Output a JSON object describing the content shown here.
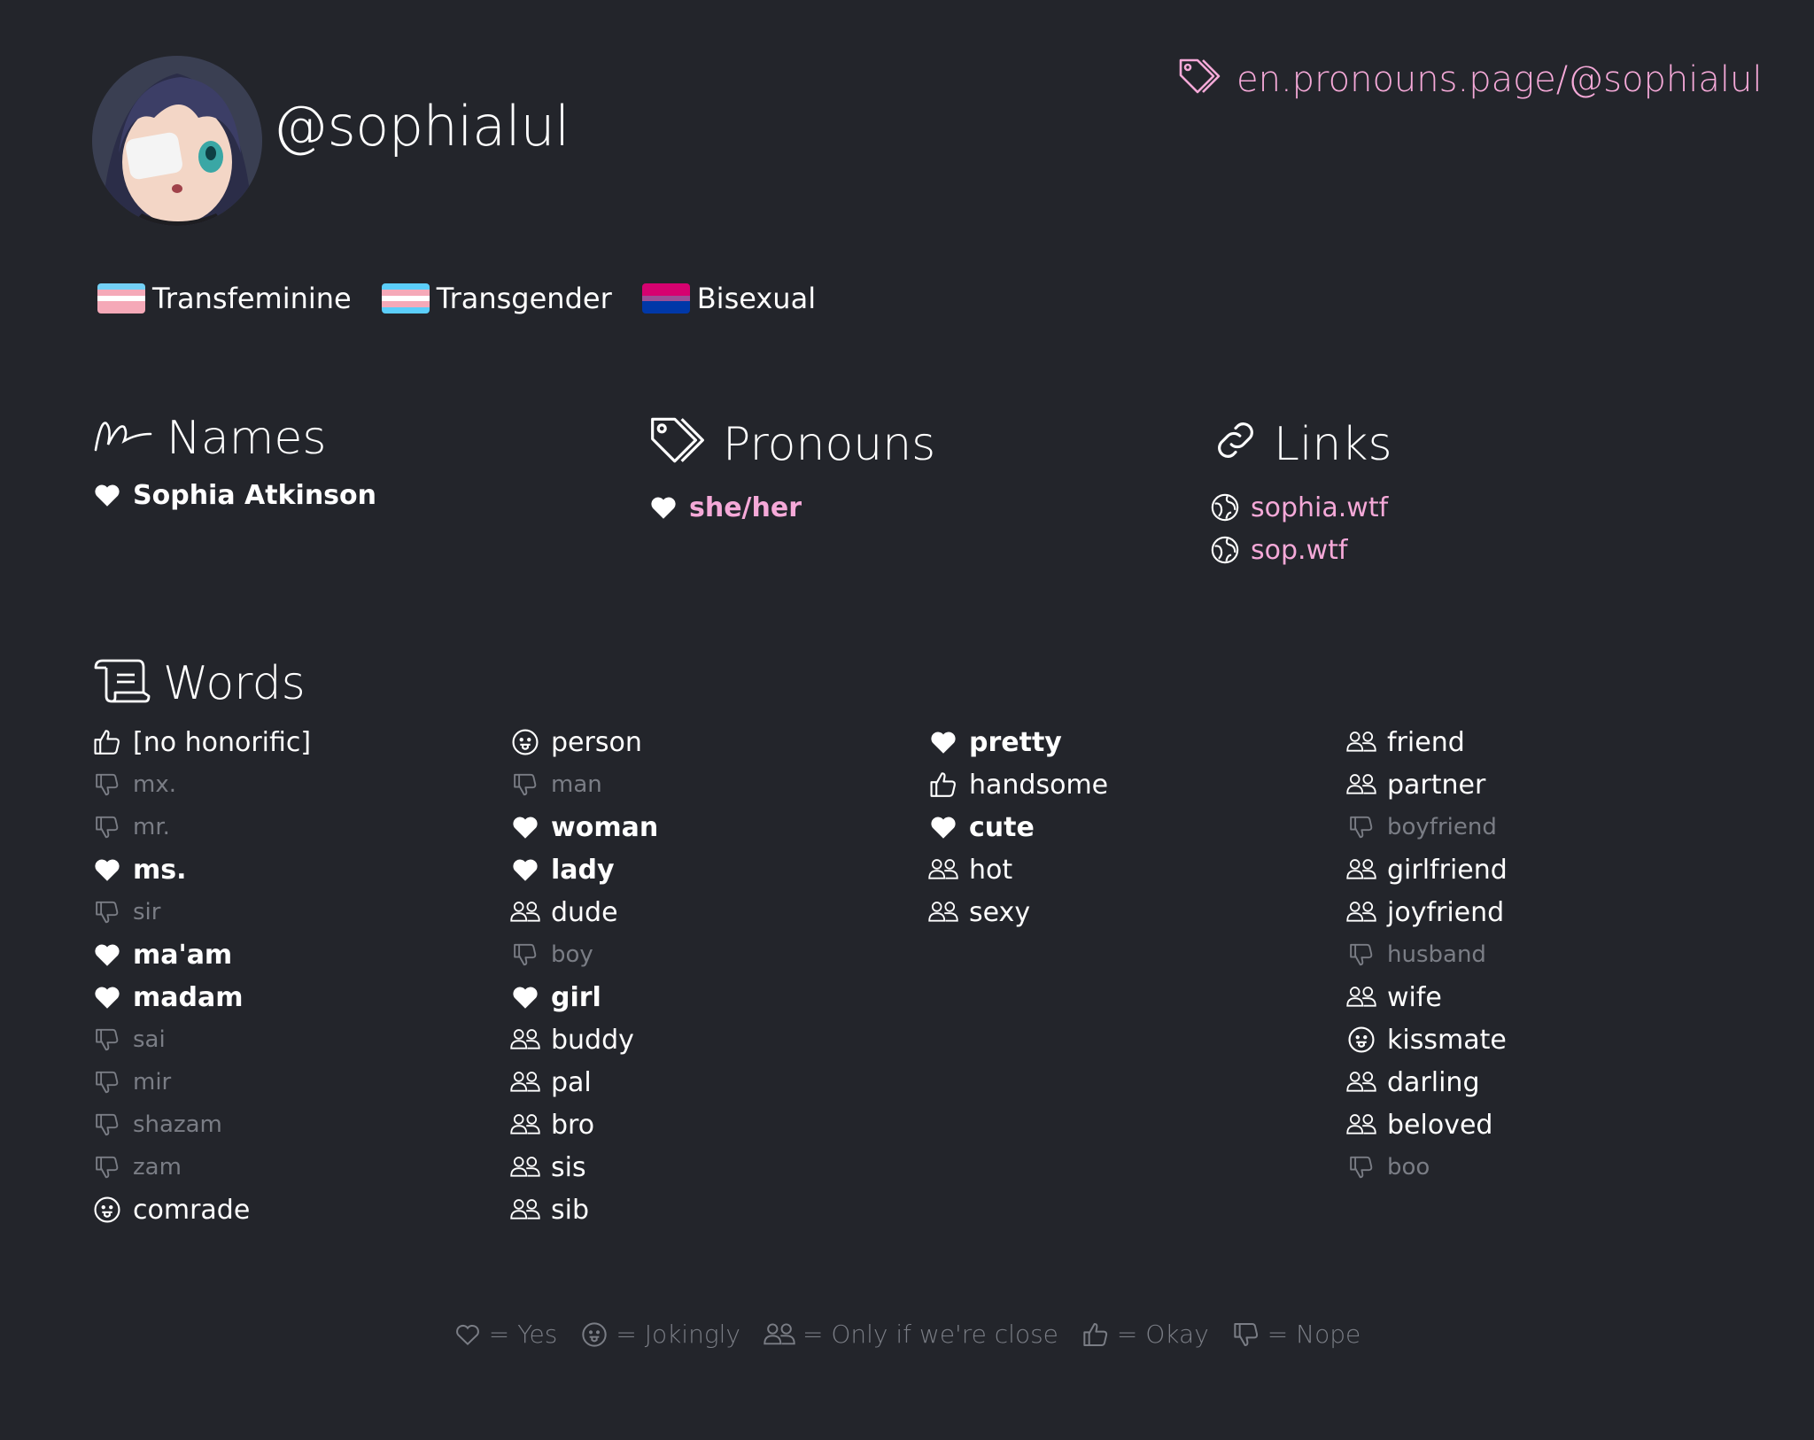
{
  "profile": {
    "username": "@sophialul",
    "page_link": "en.pronouns.page/@sophialul",
    "avatar_icon": "anime-avatar"
  },
  "flags": [
    {
      "label": "Transfeminine",
      "stripes": [
        "#73d0f5",
        "#f5a9b8",
        "#ffffff",
        "#f5a9b8",
        "#f5a9b8"
      ]
    },
    {
      "label": "Transgender",
      "stripes": [
        "#5bcefa",
        "#f5a9b8",
        "#ffffff",
        "#f5a9b8",
        "#5bcefa"
      ]
    },
    {
      "label": "Bisexual",
      "stripes": [
        "#d60270",
        "#d60270",
        "#9b4f96",
        "#0038a8",
        "#0038a8"
      ]
    }
  ],
  "sections": {
    "names_title": "Names",
    "pronouns_title": "Pronouns",
    "links_title": "Links",
    "words_title": "Words"
  },
  "names": [
    {
      "value": "Sophia Atkinson",
      "opinion": "yes"
    }
  ],
  "pronouns": [
    {
      "value": "she/her",
      "opinion": "yes"
    }
  ],
  "links": [
    {
      "value": "sophia.wtf"
    },
    {
      "value": "sop.wtf"
    }
  ],
  "words": {
    "col1": [
      {
        "value": "[no honorific]",
        "opinion": "okay"
      },
      {
        "value": "mx.",
        "opinion": "nope"
      },
      {
        "value": "mr.",
        "opinion": "nope"
      },
      {
        "value": "ms.",
        "opinion": "yes"
      },
      {
        "value": "sir",
        "opinion": "nope"
      },
      {
        "value": "ma'am",
        "opinion": "yes"
      },
      {
        "value": "madam",
        "opinion": "yes"
      },
      {
        "value": "sai",
        "opinion": "nope"
      },
      {
        "value": "mir",
        "opinion": "nope"
      },
      {
        "value": "shazam",
        "opinion": "nope"
      },
      {
        "value": "zam",
        "opinion": "nope"
      },
      {
        "value": "comrade",
        "opinion": "jokingly"
      }
    ],
    "col2": [
      {
        "value": "person",
        "opinion": "jokingly"
      },
      {
        "value": "man",
        "opinion": "nope"
      },
      {
        "value": "woman",
        "opinion": "yes"
      },
      {
        "value": "lady",
        "opinion": "yes"
      },
      {
        "value": "dude",
        "opinion": "close"
      },
      {
        "value": "boy",
        "opinion": "nope"
      },
      {
        "value": "girl",
        "opinion": "yes"
      },
      {
        "value": "buddy",
        "opinion": "close"
      },
      {
        "value": "pal",
        "opinion": "close"
      },
      {
        "value": "bro",
        "opinion": "close"
      },
      {
        "value": "sis",
        "opinion": "close"
      },
      {
        "value": "sib",
        "opinion": "close"
      }
    ],
    "col3": [
      {
        "value": "pretty",
        "opinion": "yes"
      },
      {
        "value": "handsome",
        "opinion": "okay"
      },
      {
        "value": "cute",
        "opinion": "yes"
      },
      {
        "value": "hot",
        "opinion": "close"
      },
      {
        "value": "sexy",
        "opinion": "close"
      }
    ],
    "col4": [
      {
        "value": "friend",
        "opinion": "close"
      },
      {
        "value": "partner",
        "opinion": "close"
      },
      {
        "value": "boyfriend",
        "opinion": "nope"
      },
      {
        "value": "girlfriend",
        "opinion": "close"
      },
      {
        "value": "joyfriend",
        "opinion": "close"
      },
      {
        "value": "husband",
        "opinion": "nope"
      },
      {
        "value": "wife",
        "opinion": "close"
      },
      {
        "value": "kissmate",
        "opinion": "jokingly"
      },
      {
        "value": "darling",
        "opinion": "close"
      },
      {
        "value": "beloved",
        "opinion": "close"
      },
      {
        "value": "boo",
        "opinion": "nope"
      }
    ]
  },
  "legend": [
    {
      "icon": "heart-outline-icon",
      "label": "= Yes"
    },
    {
      "icon": "tongue-face-icon",
      "label": "= Jokingly"
    },
    {
      "icon": "users-icon",
      "label": "= Only if we're close"
    },
    {
      "icon": "thumbs-up-icon",
      "label": "= Okay"
    },
    {
      "icon": "thumbs-down-icon",
      "label": "= Nope"
    }
  ],
  "colors": {
    "background": "#23252b",
    "accent": "#f5a9d8",
    "muted": "#7a7d85"
  }
}
